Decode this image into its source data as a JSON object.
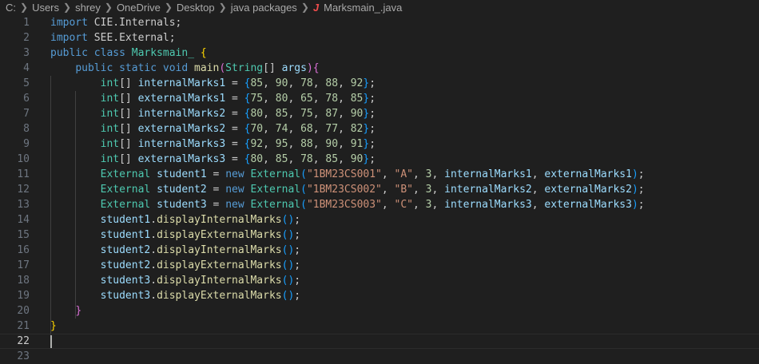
{
  "breadcrumb": {
    "items": [
      "C:",
      "Users",
      "shrey",
      "OneDrive",
      "Desktop",
      "java packages"
    ],
    "file_icon": "java-file-icon",
    "file": "Marksmain_.java"
  },
  "editor": {
    "active_line": 22,
    "lines": [
      {
        "n": "1",
        "tokens": [
          [
            "kw",
            "import "
          ],
          [
            "pl",
            "CIE.Internals;"
          ]
        ]
      },
      {
        "n": "2",
        "tokens": [
          [
            "kw",
            "import "
          ],
          [
            "pl",
            "SEE.External;"
          ]
        ]
      },
      {
        "n": "3",
        "tokens": [
          [
            "kw",
            "public class "
          ],
          [
            "ty",
            "Marksmain_"
          ],
          [
            "pl",
            " "
          ],
          [
            "br1",
            "{"
          ]
        ]
      },
      {
        "n": "4",
        "tokens": [
          [
            "pl",
            "    "
          ],
          [
            "kw",
            "public static void "
          ],
          [
            "fn",
            "main"
          ],
          [
            "br2",
            "("
          ],
          [
            "ty",
            "String"
          ],
          [
            "pl",
            "[] "
          ],
          [
            "var",
            "args"
          ],
          [
            "br2",
            ")"
          ],
          [
            "br2",
            "{"
          ]
        ]
      },
      {
        "n": "5",
        "tokens": [
          [
            "pl",
            "        "
          ],
          [
            "ty",
            "int"
          ],
          [
            "pl",
            "[] "
          ],
          [
            "var",
            "internalMarks1"
          ],
          [
            "pl",
            " = "
          ],
          [
            "br3",
            "{"
          ],
          [
            "num",
            "85"
          ],
          [
            "pl",
            ", "
          ],
          [
            "num",
            "90"
          ],
          [
            "pl",
            ", "
          ],
          [
            "num",
            "78"
          ],
          [
            "pl",
            ", "
          ],
          [
            "num",
            "88"
          ],
          [
            "pl",
            ", "
          ],
          [
            "num",
            "92"
          ],
          [
            "br3",
            "}"
          ],
          [
            "pl",
            ";"
          ]
        ]
      },
      {
        "n": "6",
        "tokens": [
          [
            "pl",
            "        "
          ],
          [
            "ty",
            "int"
          ],
          [
            "pl",
            "[] "
          ],
          [
            "var",
            "externalMarks1"
          ],
          [
            "pl",
            " = "
          ],
          [
            "br3",
            "{"
          ],
          [
            "num",
            "75"
          ],
          [
            "pl",
            ", "
          ],
          [
            "num",
            "80"
          ],
          [
            "pl",
            ", "
          ],
          [
            "num",
            "65"
          ],
          [
            "pl",
            ", "
          ],
          [
            "num",
            "78"
          ],
          [
            "pl",
            ", "
          ],
          [
            "num",
            "85"
          ],
          [
            "br3",
            "}"
          ],
          [
            "pl",
            ";"
          ]
        ]
      },
      {
        "n": "7",
        "tokens": [
          [
            "pl",
            "        "
          ],
          [
            "ty",
            "int"
          ],
          [
            "pl",
            "[] "
          ],
          [
            "var",
            "internalMarks2"
          ],
          [
            "pl",
            " = "
          ],
          [
            "br3",
            "{"
          ],
          [
            "num",
            "80"
          ],
          [
            "pl",
            ", "
          ],
          [
            "num",
            "85"
          ],
          [
            "pl",
            ", "
          ],
          [
            "num",
            "75"
          ],
          [
            "pl",
            ", "
          ],
          [
            "num",
            "87"
          ],
          [
            "pl",
            ", "
          ],
          [
            "num",
            "90"
          ],
          [
            "br3",
            "}"
          ],
          [
            "pl",
            ";"
          ]
        ]
      },
      {
        "n": "8",
        "tokens": [
          [
            "pl",
            "        "
          ],
          [
            "ty",
            "int"
          ],
          [
            "pl",
            "[] "
          ],
          [
            "var",
            "externalMarks2"
          ],
          [
            "pl",
            " = "
          ],
          [
            "br3",
            "{"
          ],
          [
            "num",
            "70"
          ],
          [
            "pl",
            ", "
          ],
          [
            "num",
            "74"
          ],
          [
            "pl",
            ", "
          ],
          [
            "num",
            "68"
          ],
          [
            "pl",
            ", "
          ],
          [
            "num",
            "77"
          ],
          [
            "pl",
            ", "
          ],
          [
            "num",
            "82"
          ],
          [
            "br3",
            "}"
          ],
          [
            "pl",
            ";"
          ]
        ]
      },
      {
        "n": "9",
        "tokens": [
          [
            "pl",
            "        "
          ],
          [
            "ty",
            "int"
          ],
          [
            "pl",
            "[] "
          ],
          [
            "var",
            "internalMarks3"
          ],
          [
            "pl",
            " = "
          ],
          [
            "br3",
            "{"
          ],
          [
            "num",
            "92"
          ],
          [
            "pl",
            ", "
          ],
          [
            "num",
            "95"
          ],
          [
            "pl",
            ", "
          ],
          [
            "num",
            "88"
          ],
          [
            "pl",
            ", "
          ],
          [
            "num",
            "90"
          ],
          [
            "pl",
            ", "
          ],
          [
            "num",
            "91"
          ],
          [
            "br3",
            "}"
          ],
          [
            "pl",
            ";"
          ]
        ]
      },
      {
        "n": "10",
        "tokens": [
          [
            "pl",
            "        "
          ],
          [
            "ty",
            "int"
          ],
          [
            "pl",
            "[] "
          ],
          [
            "var",
            "externalMarks3"
          ],
          [
            "pl",
            " = "
          ],
          [
            "br3",
            "{"
          ],
          [
            "num",
            "80"
          ],
          [
            "pl",
            ", "
          ],
          [
            "num",
            "85"
          ],
          [
            "pl",
            ", "
          ],
          [
            "num",
            "78"
          ],
          [
            "pl",
            ", "
          ],
          [
            "num",
            "85"
          ],
          [
            "pl",
            ", "
          ],
          [
            "num",
            "90"
          ],
          [
            "br3",
            "}"
          ],
          [
            "pl",
            ";"
          ]
        ]
      },
      {
        "n": "11",
        "tokens": [
          [
            "pl",
            "        "
          ],
          [
            "ty",
            "External"
          ],
          [
            "pl",
            " "
          ],
          [
            "var",
            "student1"
          ],
          [
            "pl",
            " = "
          ],
          [
            "kw",
            "new "
          ],
          [
            "ty",
            "External"
          ],
          [
            "br3",
            "("
          ],
          [
            "str",
            "\"1BM23CS001\""
          ],
          [
            "pl",
            ", "
          ],
          [
            "str",
            "\"A\""
          ],
          [
            "pl",
            ", "
          ],
          [
            "num",
            "3"
          ],
          [
            "pl",
            ", "
          ],
          [
            "var",
            "internalMarks1"
          ],
          [
            "pl",
            ", "
          ],
          [
            "var",
            "externalMarks1"
          ],
          [
            "br3",
            ")"
          ],
          [
            "pl",
            ";"
          ]
        ]
      },
      {
        "n": "12",
        "tokens": [
          [
            "pl",
            "        "
          ],
          [
            "ty",
            "External"
          ],
          [
            "pl",
            " "
          ],
          [
            "var",
            "student2"
          ],
          [
            "pl",
            " = "
          ],
          [
            "kw",
            "new "
          ],
          [
            "ty",
            "External"
          ],
          [
            "br3",
            "("
          ],
          [
            "str",
            "\"1BM23CS002\""
          ],
          [
            "pl",
            ", "
          ],
          [
            "str",
            "\"B\""
          ],
          [
            "pl",
            ", "
          ],
          [
            "num",
            "3"
          ],
          [
            "pl",
            ", "
          ],
          [
            "var",
            "internalMarks2"
          ],
          [
            "pl",
            ", "
          ],
          [
            "var",
            "externalMarks2"
          ],
          [
            "br3",
            ")"
          ],
          [
            "pl",
            ";"
          ]
        ]
      },
      {
        "n": "13",
        "tokens": [
          [
            "pl",
            "        "
          ],
          [
            "ty",
            "External"
          ],
          [
            "pl",
            " "
          ],
          [
            "var",
            "student3"
          ],
          [
            "pl",
            " = "
          ],
          [
            "kw",
            "new "
          ],
          [
            "ty",
            "External"
          ],
          [
            "br3",
            "("
          ],
          [
            "str",
            "\"1BM23CS003\""
          ],
          [
            "pl",
            ", "
          ],
          [
            "str",
            "\"C\""
          ],
          [
            "pl",
            ", "
          ],
          [
            "num",
            "3"
          ],
          [
            "pl",
            ", "
          ],
          [
            "var",
            "internalMarks3"
          ],
          [
            "pl",
            ", "
          ],
          [
            "var",
            "externalMarks3"
          ],
          [
            "br3",
            ")"
          ],
          [
            "pl",
            ";"
          ]
        ]
      },
      {
        "n": "14",
        "tokens": [
          [
            "pl",
            "        "
          ],
          [
            "var",
            "student1"
          ],
          [
            "pl",
            "."
          ],
          [
            "fn",
            "displayInternalMarks"
          ],
          [
            "br3",
            "()"
          ],
          [
            "pl",
            ";"
          ]
        ]
      },
      {
        "n": "15",
        "tokens": [
          [
            "pl",
            "        "
          ],
          [
            "var",
            "student1"
          ],
          [
            "pl",
            "."
          ],
          [
            "fn",
            "displayExternalMarks"
          ],
          [
            "br3",
            "()"
          ],
          [
            "pl",
            ";"
          ]
        ]
      },
      {
        "n": "16",
        "tokens": [
          [
            "pl",
            "        "
          ],
          [
            "var",
            "student2"
          ],
          [
            "pl",
            "."
          ],
          [
            "fn",
            "displayInternalMarks"
          ],
          [
            "br3",
            "()"
          ],
          [
            "pl",
            ";"
          ]
        ]
      },
      {
        "n": "17",
        "tokens": [
          [
            "pl",
            "        "
          ],
          [
            "var",
            "student2"
          ],
          [
            "pl",
            "."
          ],
          [
            "fn",
            "displayExternalMarks"
          ],
          [
            "br3",
            "()"
          ],
          [
            "pl",
            ";"
          ]
        ]
      },
      {
        "n": "18",
        "tokens": [
          [
            "pl",
            "        "
          ],
          [
            "var",
            "student3"
          ],
          [
            "pl",
            "."
          ],
          [
            "fn",
            "displayInternalMarks"
          ],
          [
            "br3",
            "()"
          ],
          [
            "pl",
            ";"
          ]
        ]
      },
      {
        "n": "19",
        "tokens": [
          [
            "pl",
            "        "
          ],
          [
            "var",
            "student3"
          ],
          [
            "pl",
            "."
          ],
          [
            "fn",
            "displayExternalMarks"
          ],
          [
            "br3",
            "()"
          ],
          [
            "pl",
            ";"
          ]
        ]
      },
      {
        "n": "20",
        "tokens": [
          [
            "pl",
            "    "
          ],
          [
            "br2",
            "}"
          ]
        ]
      },
      {
        "n": "21",
        "tokens": [
          [
            "br1",
            "}"
          ]
        ]
      },
      {
        "n": "22",
        "tokens": []
      },
      {
        "n": "23",
        "tokens": []
      }
    ]
  }
}
